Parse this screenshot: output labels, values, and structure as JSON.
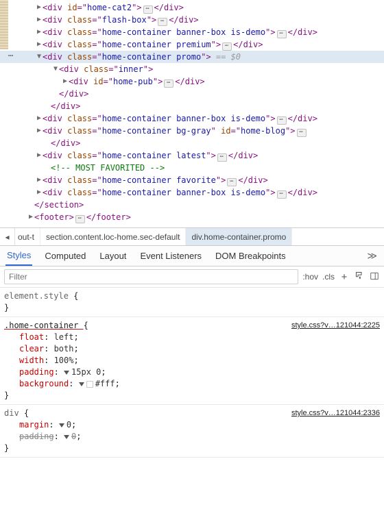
{
  "dom": {
    "rows": [
      {
        "indent": 44,
        "arrow": "right",
        "open": "<div id=",
        "attrs": [
          [
            "id",
            "home-cat2"
          ]
        ],
        "afterOpen": ">",
        "dots": true,
        "close": "</div>",
        "selected": false
      },
      {
        "indent": 44,
        "arrow": "right",
        "open": "<div class=",
        "attrs": [
          [
            "class",
            "flash-box"
          ]
        ],
        "afterOpen": ">",
        "dots": true,
        "close": "</div>",
        "selected": false
      },
      {
        "indent": 44,
        "arrow": "right",
        "open": "<div class=",
        "attrs": [
          [
            "class",
            "home-container banner-box is-demo"
          ]
        ],
        "afterOpen": ">",
        "dots": true,
        "close": "</div>",
        "selected": false
      },
      {
        "indent": 44,
        "arrow": "right",
        "open": "<div class=",
        "attrs": [
          [
            "class",
            "home-container premium"
          ]
        ],
        "afterOpen": ">",
        "dots": true,
        "close": "</div>",
        "selected": false
      },
      {
        "indent": 44,
        "arrow": "down",
        "open": "<div class=",
        "attrs": [
          [
            "class",
            "home-container promo"
          ]
        ],
        "afterOpen": ">",
        "trailer": " == $0",
        "selected": true,
        "gutterDots": true
      },
      {
        "indent": 68,
        "arrow": "down",
        "open": "<div class=",
        "attrs": [
          [
            "class",
            "inner"
          ]
        ],
        "afterOpen": ">",
        "selected": false
      },
      {
        "indent": 82,
        "arrow": "right",
        "open": "<div id=",
        "attrs": [
          [
            "id",
            "home-pub"
          ]
        ],
        "afterOpen": ">",
        "dots": true,
        "close": "</div>",
        "selected": false
      },
      {
        "indent": 68,
        "arrow": "none",
        "rawClose": "</div>"
      },
      {
        "indent": 56,
        "arrow": "none",
        "rawClose": "</div>"
      },
      {
        "indent": 44,
        "arrow": "right",
        "open": "<div class=",
        "attrs": [
          [
            "class",
            "home-container banner-box is-demo"
          ]
        ],
        "afterOpen": ">",
        "dots": true,
        "close": "</div>",
        "selected": false
      },
      {
        "indent": 44,
        "arrow": "right",
        "open_multi": [
          [
            "class",
            "home-container bg-gray"
          ],
          [
            "id",
            "home-blog"
          ]
        ],
        "afterOpen": ">",
        "dots": true,
        "closeBelow": true
      },
      {
        "indent": 56,
        "arrow": "none",
        "rawClose": "</div>"
      },
      {
        "indent": 44,
        "arrow": "right",
        "open": "<div class=",
        "attrs": [
          [
            "class",
            "home-container latest"
          ]
        ],
        "afterOpen": ">",
        "dots": true,
        "close": "</div>",
        "selected": false
      },
      {
        "indent": 56,
        "arrow": "none",
        "comment": "<!-- MOST FAVORITED -->"
      },
      {
        "indent": 44,
        "arrow": "right",
        "open": "<div class=",
        "attrs": [
          [
            "class",
            "home-container favorite"
          ]
        ],
        "afterOpen": ">",
        "dots": true,
        "close": "</div>",
        "selected": false
      },
      {
        "indent": 44,
        "arrow": "right",
        "open": "<div class=",
        "attrs": [
          [
            "class",
            "home-container banner-box is-demo"
          ]
        ],
        "afterOpen": ">",
        "dots": true,
        "close": "</div>",
        "selected": false
      },
      {
        "indent": 32,
        "arrow": "none",
        "rawClose": "</section>"
      },
      {
        "indent": 32,
        "arrow": "right",
        "open": "<footer",
        "attrs": [],
        "afterOpen": ">",
        "dots": true,
        "close": "</footer>",
        "opentag": "footer"
      }
    ]
  },
  "breadcrumbs": {
    "scroll_back": "◂",
    "items": [
      {
        "label": "out-t",
        "partial": true
      },
      {
        "label": "section.content.loc-home.sec-default"
      },
      {
        "label": "div.home-container.promo",
        "active": true
      }
    ]
  },
  "tabs": {
    "items": [
      {
        "label": "Styles",
        "active": true
      },
      {
        "label": "Computed"
      },
      {
        "label": "Layout"
      },
      {
        "label": "Event Listeners"
      },
      {
        "label": "DOM Breakpoints"
      }
    ],
    "more_label": "≫"
  },
  "toolbar": {
    "filter_placeholder": "Filter",
    "hov_label": ":hov",
    "cls_label": ".cls"
  },
  "styles": {
    "rules": [
      {
        "selector": "element.style",
        "selector_gray": true,
        "decls": []
      },
      {
        "selector": ".home-container",
        "underlined": true,
        "source": "style.css?v…121044:2225",
        "decls": [
          {
            "prop": "float",
            "val": "left"
          },
          {
            "prop": "clear",
            "val": "both"
          },
          {
            "prop": "width",
            "val": "100%"
          },
          {
            "prop": "padding",
            "val": "15px 0",
            "expand": true
          },
          {
            "prop": "background",
            "val": "#fff",
            "expand": true,
            "swatch": "#fff"
          }
        ]
      },
      {
        "selector": "div",
        "selector_gray": true,
        "source": "style.css?v…121044:2336",
        "decls": [
          {
            "prop": "margin",
            "val": "0",
            "expand": true
          },
          {
            "prop": "padding",
            "val": "0",
            "expand": true,
            "struck": true
          }
        ]
      }
    ]
  }
}
